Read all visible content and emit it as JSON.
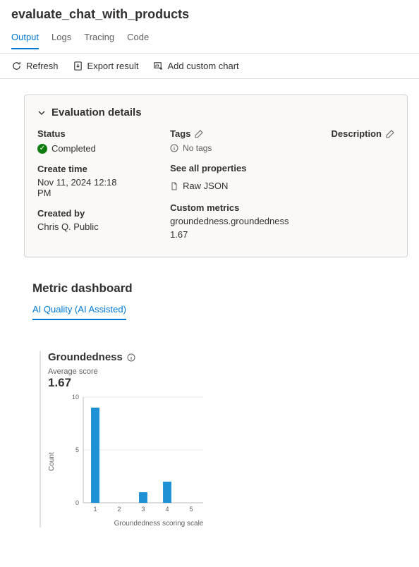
{
  "page_title": "evaluate_chat_with_products",
  "tabs": [
    "Output",
    "Logs",
    "Tracing",
    "Code"
  ],
  "active_tab": 0,
  "toolbar": {
    "refresh": "Refresh",
    "export": "Export result",
    "add_chart": "Add custom chart"
  },
  "details": {
    "title": "Evaluation details",
    "status_label": "Status",
    "status_value": "Completed",
    "create_time_label": "Create time",
    "create_time_value": "Nov 11, 2024 12:18 PM",
    "created_by_label": "Created by",
    "created_by_value": "Chris Q. Public",
    "tags_label": "Tags",
    "tags_value": "No tags",
    "see_all": "See all properties",
    "raw_json": "Raw JSON",
    "custom_metrics_label": "Custom metrics",
    "custom_metric_name": "groundedness.groundedness",
    "custom_metric_value": "1.67",
    "description_label": "Description"
  },
  "dashboard": {
    "title": "Metric dashboard",
    "subtab": "AI Quality (AI Assisted)",
    "groundedness": {
      "title": "Groundedness",
      "avg_label": "Average score",
      "avg_value": "1.67"
    }
  },
  "chart_data": {
    "type": "bar",
    "title": "Groundedness",
    "xlabel": "Groundedness scoring scale",
    "ylabel": "Count",
    "categories": [
      "1",
      "2",
      "3",
      "4",
      "5"
    ],
    "values": [
      9,
      0,
      1,
      2,
      0
    ],
    "ylim": [
      0,
      10
    ],
    "yticks": [
      0,
      5,
      10
    ]
  }
}
